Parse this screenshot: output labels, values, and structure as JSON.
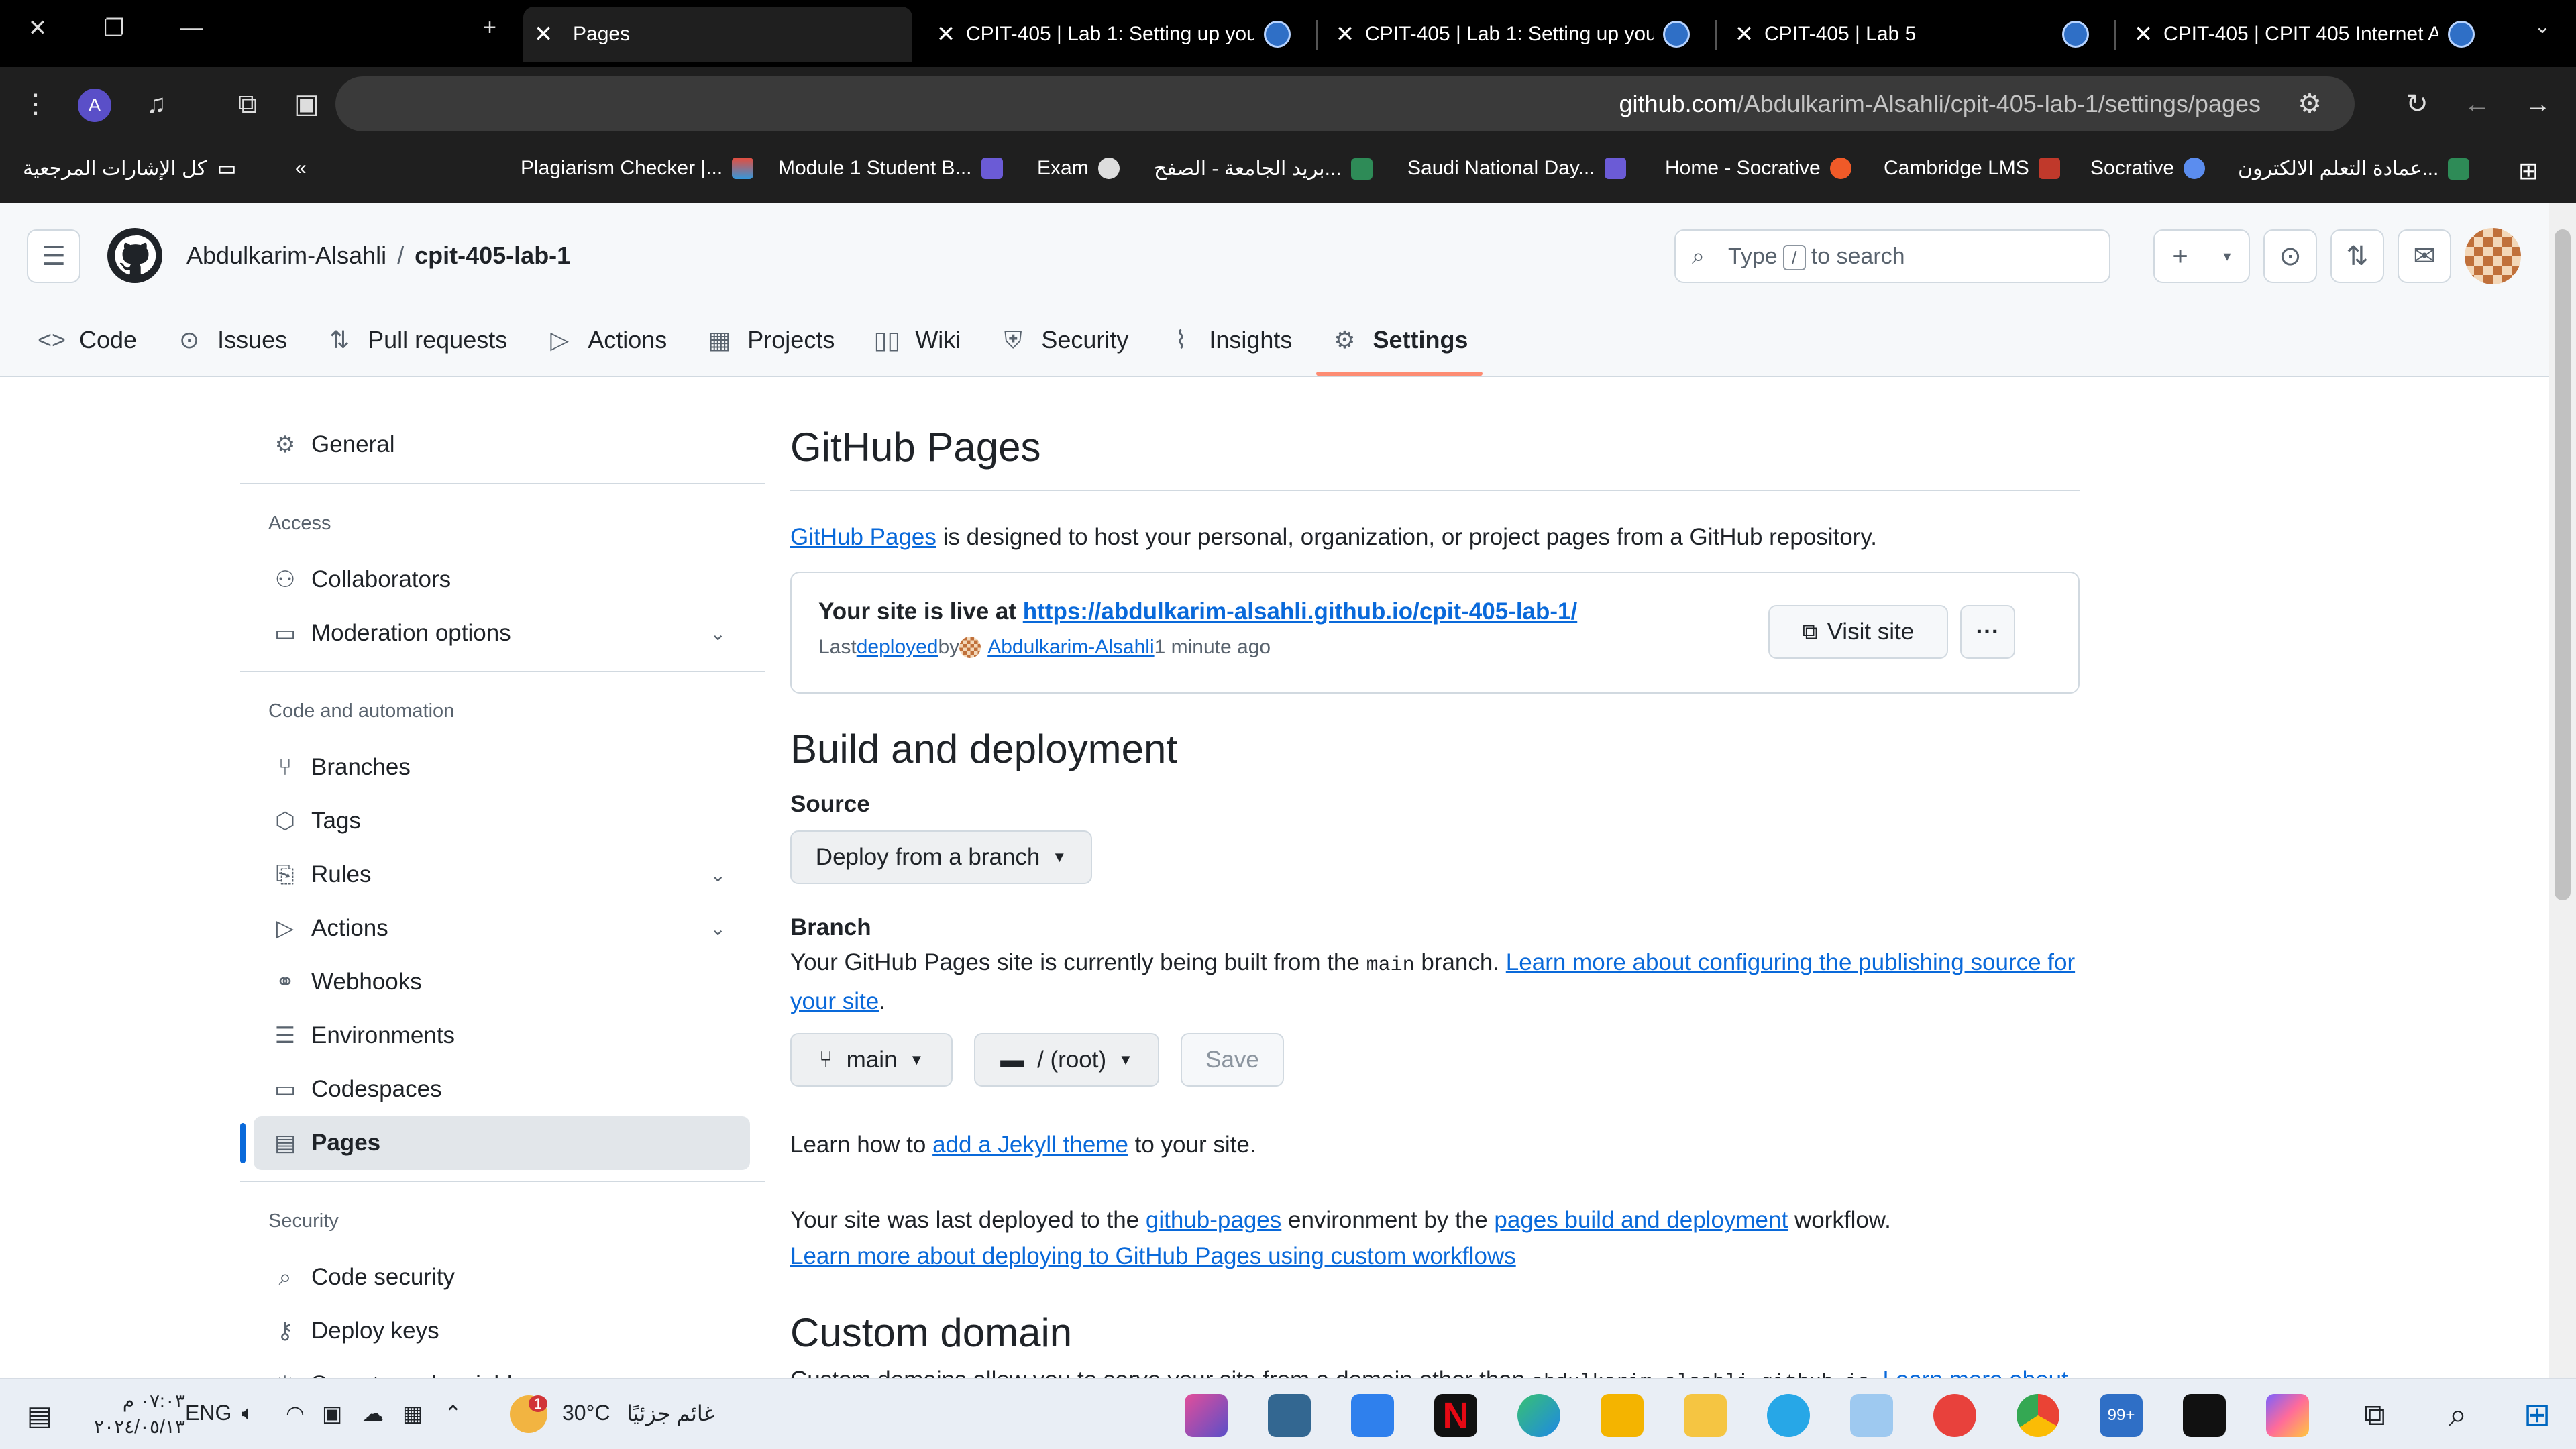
{
  "browser": {
    "tabs": [
      {
        "title": "Pages",
        "active": true
      },
      {
        "title": "CPIT-405 | Lab 1: Setting up you"
      },
      {
        "title": "CPIT-405 | Lab 1: Setting up you"
      },
      {
        "title": "CPIT-405 | Lab 5"
      },
      {
        "title": "CPIT-405 | CPIT 405 Internet Ap"
      }
    ],
    "new_tab": "+",
    "url_host": "github.com",
    "url_path": "/Abdulkarim-Alsahli/cpit-405-lab-1/settings/pages",
    "profile_initial": "A",
    "bookmarks": [
      "Plagiarism Checker |...",
      "Module 1 Student B...",
      "Exam",
      "بريد الجامعة - الصفح...",
      "Saudi National Day...",
      "Home - Socrative",
      "Cambridge LMS",
      "Socrative",
      "عمادة التعلم الالكترون..."
    ],
    "all_bookmarks": "كل الإشارات المرجعية",
    "bookmarks_collapse": "«"
  },
  "github": {
    "owner": "Abdulkarim-Alsahli",
    "crumb_sep": "/",
    "repo": "cpit-405-lab-1",
    "search_pre": "Type",
    "search_key": "/",
    "search_post": "to search",
    "nav": [
      {
        "label": "Code",
        "icon": "<>"
      },
      {
        "label": "Issues",
        "icon": "⊙"
      },
      {
        "label": "Pull requests",
        "icon": "⇅"
      },
      {
        "label": "Actions",
        "icon": "▷"
      },
      {
        "label": "Projects",
        "icon": "▦"
      },
      {
        "label": "Wiki",
        "icon": "📖"
      },
      {
        "label": "Security",
        "icon": "⛨"
      },
      {
        "label": "Insights",
        "icon": "⌇"
      },
      {
        "label": "Settings",
        "icon": "⚙",
        "selected": true
      }
    ]
  },
  "sidebar": {
    "general": "General",
    "access_heading": "Access",
    "collaborators": "Collaborators",
    "moderation": "Moderation options",
    "code_heading": "Code and automation",
    "branches": "Branches",
    "tags": "Tags",
    "rules": "Rules",
    "actions": "Actions",
    "webhooks": "Webhooks",
    "environments": "Environments",
    "codespaces": "Codespaces",
    "pages": "Pages",
    "security_heading": "Security",
    "code_security": "Code security",
    "deploy_keys": "Deploy keys",
    "secrets": "Secrets and variables"
  },
  "main": {
    "title": "GitHub Pages",
    "intro_link": "GitHub Pages",
    "intro_rest": " is designed to host your personal, organization, or project pages from a GitHub repository.",
    "live_pre": "Your site is live at ",
    "live_url": "https://abdulkarim-alsahli.github.io/cpit-405-lab-1/",
    "last": "Last ",
    "deployed": "deployed",
    "by": " by ",
    "deployer": "Abdulkarim-Alsahli",
    "ago": " 1 minute ago",
    "visit_site": "Visit site",
    "more": "···",
    "build_title": "Build and deployment",
    "source_label": "Source",
    "source_value": "Deploy from a branch",
    "branch_label": "Branch",
    "branch_text_1": "Your GitHub Pages site is currently being built from the ",
    "branch_code": "main",
    "branch_text_2": " branch. ",
    "branch_link": "Learn more about configuring the publishing source for your site",
    "branch_period": ".",
    "branch_select": "main",
    "folder_select": "/ (root)",
    "save": "Save",
    "jekyll_pre": "Learn how to ",
    "jekyll_link": "add a Jekyll theme",
    "jekyll_post": " to your site.",
    "workflow_1": "Your site was last deployed to the ",
    "workflow_env": "github-pages",
    "workflow_2": " environment by the ",
    "workflow_link": "pages build and deployment",
    "workflow_3": " workflow.",
    "workflow_learn": "Learn more about deploying to GitHub Pages using custom workflows",
    "custom_title": "Custom domain",
    "custom_text": "Custom domains allow you to serve your site from a domain other than ",
    "custom_code": "abdulkarim-alsahli.github.io",
    "custom_learn": ". Learn more about"
  },
  "taskbar": {
    "time": "٠٧:٠٣ م",
    "date": "٢٠٢٤/٠٥/١٣",
    "lang": "ENG",
    "temp": "30°C",
    "weather": "غائم جزئيًا",
    "notif_count": "99+",
    "weather_badge": "1"
  },
  "colors": {
    "accent": "#0969da",
    "selected_tab_underline": "#fd8c73",
    "chrome_dark": "#1f1f1f"
  }
}
